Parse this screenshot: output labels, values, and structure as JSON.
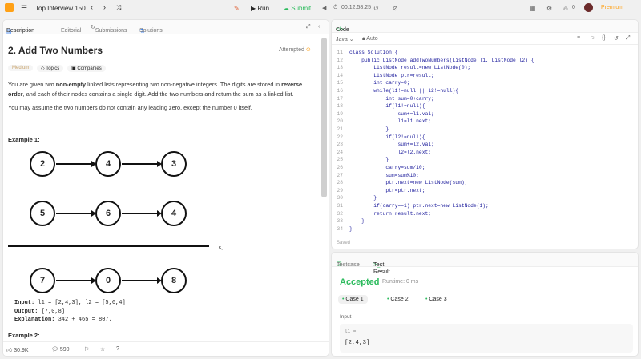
{
  "topbar": {
    "list_title": "Top Interview 150",
    "run": "Run",
    "submit": "Submit",
    "timer": "00:12:58:25",
    "streak": "0",
    "premium": "Premium"
  },
  "left_tabs": {
    "description": "Description",
    "editorial": "Editorial",
    "submissions": "Submissions",
    "solutions": "Solutions"
  },
  "problem": {
    "title": "2. Add Two Numbers",
    "attempted": "Attempted",
    "difficulty": "Medium",
    "topics": "Topics",
    "companies": "Companies",
    "p1_a": "You are given two ",
    "p1_b": "non-empty",
    "p1_c": " linked lists representing two non-negative integers. The digits are stored in ",
    "p1_d": "reverse order",
    "p1_e": ", and each of their nodes contains a single digit. Add the two numbers and return the sum as a linked list.",
    "p2": "You may assume the two numbers do not contain any leading zero, except the number 0 itself.",
    "example1": "Example 1:",
    "example2": "Example 2:",
    "list1": [
      "2",
      "4",
      "3"
    ],
    "list2": [
      "5",
      "6",
      "4"
    ],
    "list3": [
      "7",
      "0",
      "8"
    ],
    "input_label": "Input:",
    "input_val": "l1 = [2,4,3], l2 = [5,6,4]",
    "output_label": "Output:",
    "output_val": "[7,0,8]",
    "expl_label": "Explanation:",
    "expl_val": "342 + 465 = 807."
  },
  "footer": {
    "likes": "30.9K",
    "comments": "590"
  },
  "code": {
    "title": "Code",
    "lang": "Java",
    "auto": "Auto",
    "saved": "Saved",
    "lines": [
      [
        "11",
        "class Solution {"
      ],
      [
        "12",
        "    public ListNode addTwoNumbers(ListNode l1, ListNode l2) {"
      ],
      [
        "13",
        "        ListNode result=new ListNode(0);"
      ],
      [
        "14",
        "        ListNode ptr=result;"
      ],
      [
        "15",
        "        int carry=0;"
      ],
      [
        "16",
        "        while(l1!=null || l2!=null){"
      ],
      [
        "17",
        "            int sum=0+carry;"
      ],
      [
        "18",
        "            if(l1!=null){"
      ],
      [
        "19",
        "                sum+=l1.val;"
      ],
      [
        "20",
        "                l1=l1.next;"
      ],
      [
        "21",
        "            }"
      ],
      [
        "22",
        "            if(l2!=null){"
      ],
      [
        "23",
        "                sum+=l2.val;"
      ],
      [
        "24",
        "                l2=l2.next;"
      ],
      [
        "25",
        "            }"
      ],
      [
        "26",
        "            carry=sum/10;"
      ],
      [
        "27",
        "            sum=sum%10;"
      ],
      [
        "28",
        "            ptr.next=new ListNode(sum);"
      ],
      [
        "29",
        "            ptr=ptr.next;"
      ],
      [
        "30",
        "        }"
      ],
      [
        "31",
        "        if(carry==1) ptr.next=new ListNode(1);"
      ],
      [
        "32",
        "        return result.next;"
      ],
      [
        "33",
        "    }"
      ],
      [
        "34",
        "}"
      ]
    ]
  },
  "result": {
    "testcase_tab": "Testcase",
    "result_tab": "Test Result",
    "accepted": "Accepted",
    "runtime": "Runtime: 0 ms",
    "cases": [
      "Case 1",
      "Case 2",
      "Case 3"
    ],
    "input_label": "Input",
    "var_label": "l1 =",
    "var_value": "[2,4,3]"
  }
}
